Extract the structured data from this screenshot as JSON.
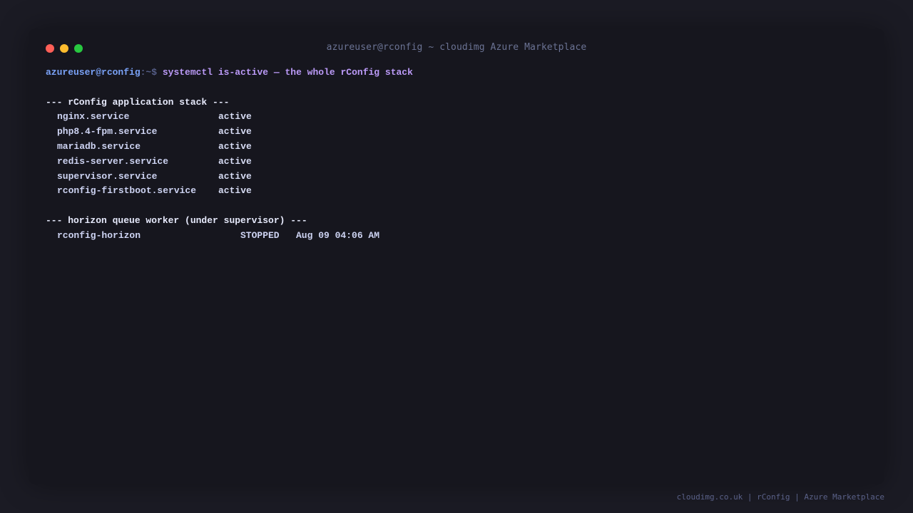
{
  "window": {
    "title": "azureuser@rconfig ~ cloudimg Azure Marketplace"
  },
  "prompt": {
    "user_host": "azureuser@rconfig",
    "path": ":~$ ",
    "command": "systemctl is-active — the whole rConfig stack"
  },
  "stack": {
    "heading": "--- rConfig application stack ---",
    "services": [
      {
        "name": "nginx.service",
        "state": "active"
      },
      {
        "name": "php8.4-fpm.service",
        "state": "active"
      },
      {
        "name": "mariadb.service",
        "state": "active"
      },
      {
        "name": "redis-server.service",
        "state": "active"
      },
      {
        "name": "supervisor.service",
        "state": "active"
      },
      {
        "name": "rconfig-firstboot.service",
        "state": "active"
      }
    ]
  },
  "horizon": {
    "heading": "--- horizon queue worker (under supervisor) ---",
    "worker": {
      "name": "rconfig-horizon",
      "state": "STOPPED",
      "time": "Aug 09 04:06 AM"
    }
  },
  "footer": {
    "text": "cloudimg.co.uk | rConfig | Azure Marketplace"
  }
}
